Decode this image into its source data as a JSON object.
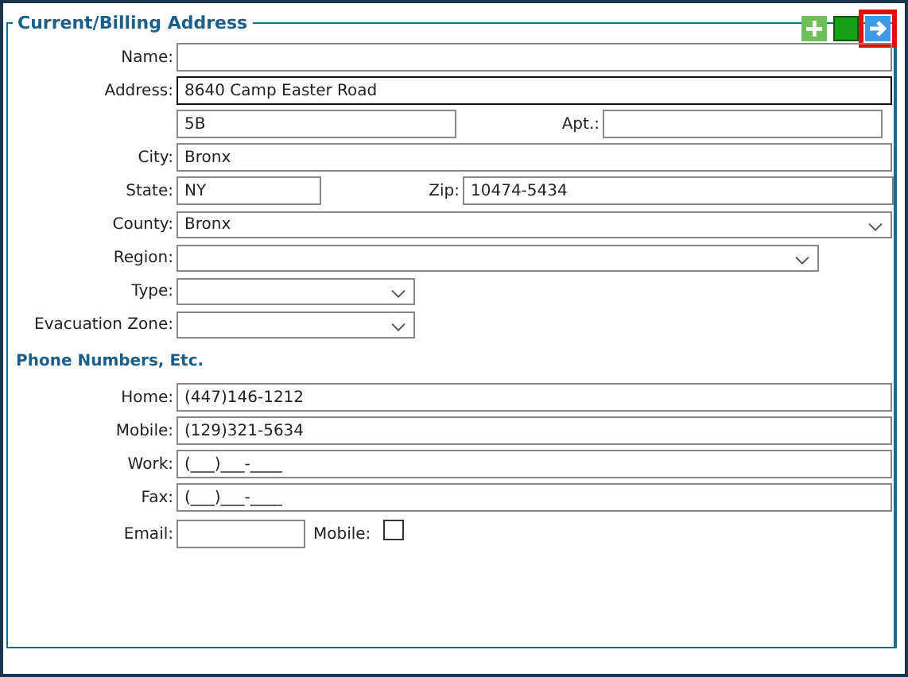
{
  "section_title": "Current/Billing Address",
  "header_buttons": [
    {
      "kind": "add",
      "highlighted": false
    },
    {
      "kind": "square",
      "highlighted": false
    },
    {
      "kind": "arrow",
      "highlighted": true
    }
  ],
  "address_rows": [
    {
      "items": [
        {
          "label": "Name:",
          "kind": "text",
          "value": "",
          "focused": false
        }
      ]
    },
    {
      "items": [
        {
          "label": "Address:",
          "kind": "text",
          "value": "8640 Camp Easter Road",
          "focused": true
        }
      ]
    },
    {
      "items": [
        {
          "kind": "text",
          "value": "5B",
          "focused": false
        },
        {
          "label": "Apt.:",
          "kind": "text",
          "value": "",
          "focused": false
        }
      ]
    },
    {
      "items": [
        {
          "label": "City:",
          "kind": "text",
          "value": "Bronx",
          "focused": false
        }
      ]
    },
    {
      "items": [
        {
          "label": "State:",
          "kind": "text",
          "value": "NY",
          "focused": false
        },
        {
          "label": "Zip:",
          "kind": "text",
          "value": "10474-5434",
          "focused": false
        }
      ]
    },
    {
      "items": [
        {
          "label": "County:",
          "kind": "select",
          "value": "Bronx"
        }
      ]
    },
    {
      "items": [
        {
          "label": "Region:",
          "kind": "select",
          "value": ""
        }
      ]
    },
    {
      "items": [
        {
          "label": "Type:",
          "kind": "select",
          "value": ""
        }
      ]
    },
    {
      "items": [
        {
          "label": "Evacuation Zone:",
          "kind": "select",
          "value": ""
        }
      ]
    }
  ],
  "phone_title": "Phone Numbers, Etc.",
  "phone_rows": [
    {
      "items": [
        {
          "label": "Home:",
          "kind": "text",
          "value": "(447)146-1212",
          "focused": false
        }
      ]
    },
    {
      "items": [
        {
          "label": "Mobile:",
          "kind": "text",
          "value": "(129)321-5634",
          "focused": false
        }
      ]
    },
    {
      "items": [
        {
          "label": "Work:",
          "kind": "text",
          "value": "(___)___-____",
          "focused": false
        }
      ]
    },
    {
      "items": [
        {
          "label": "Fax:",
          "kind": "text",
          "value": "(___)___-____",
          "focused": false
        }
      ]
    },
    {
      "items": [
        {
          "label": "Email:",
          "kind": "text",
          "value": "",
          "focused": false
        },
        {
          "label": "Mobile:",
          "kind": "checkbox",
          "checked": false
        }
      ]
    }
  ]
}
